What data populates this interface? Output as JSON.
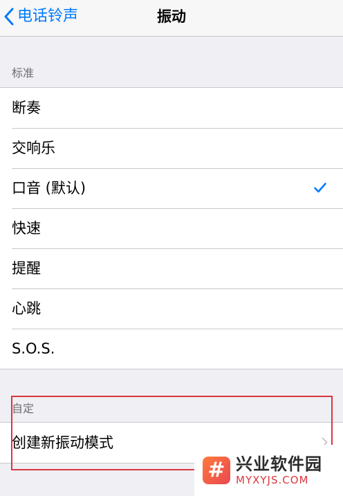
{
  "navbar": {
    "back_label": "电话铃声",
    "title": "振动"
  },
  "standard": {
    "header": "标准",
    "items": [
      {
        "label": "断奏",
        "selected": false
      },
      {
        "label": "交响乐",
        "selected": false
      },
      {
        "label": "口音 (默认)",
        "selected": true
      },
      {
        "label": "快速",
        "selected": false
      },
      {
        "label": "提醒",
        "selected": false
      },
      {
        "label": "心跳",
        "selected": false
      },
      {
        "label": "S.O.S.",
        "selected": false
      }
    ]
  },
  "custom": {
    "header": "自定",
    "create_label": "创建新振动模式"
  },
  "watermark": {
    "logo_glyph": "#",
    "name": "兴业软件园",
    "domain": "MYXYJS.COM"
  },
  "colors": {
    "accent": "#007aff",
    "highlight": "#d9363e",
    "background": "#efeff4"
  },
  "icons": {
    "back": "chevron-left-icon",
    "selected": "checkmark-icon",
    "disclosure": "chevron-right-icon"
  }
}
